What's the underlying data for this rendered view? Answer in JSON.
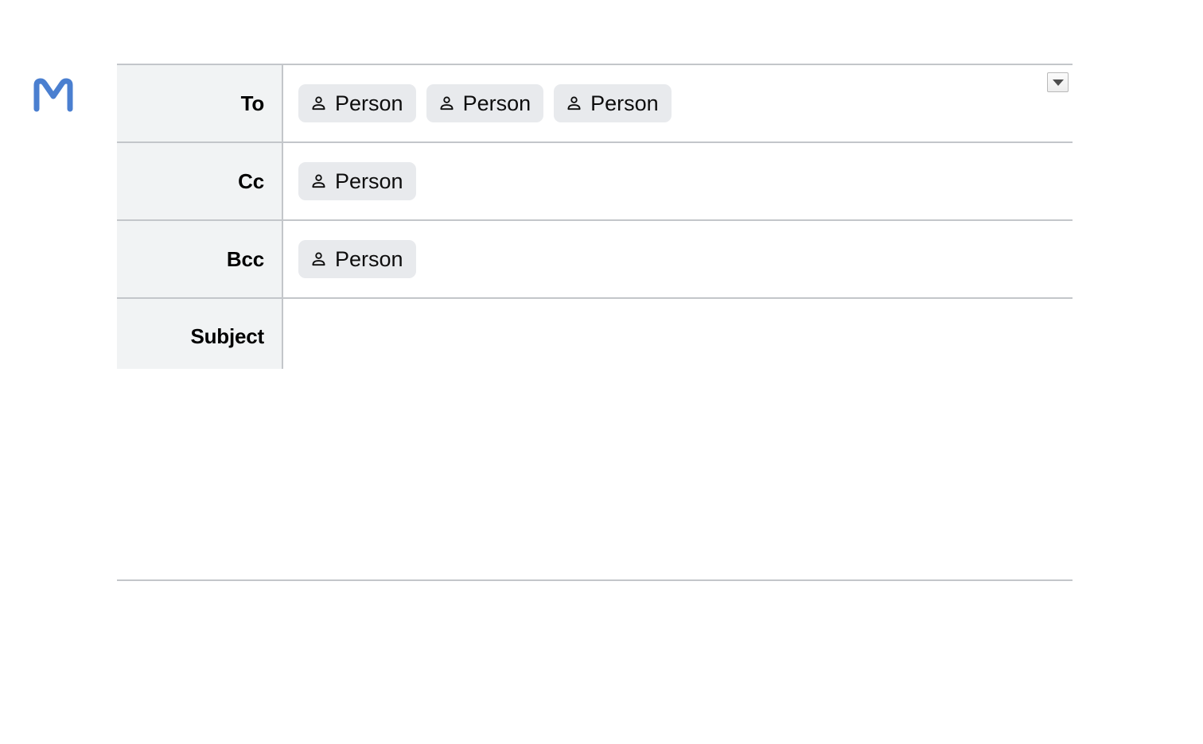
{
  "app": {
    "logo_icon": "gmail-m-logo-icon",
    "logo_color": "#4a7fd0"
  },
  "compose": {
    "expand_button": {
      "icon": "chevron-down-icon",
      "label": ""
    },
    "rows": [
      {
        "key": "to",
        "label": "To",
        "chips": [
          {
            "icon": "person-icon",
            "label": "Person"
          },
          {
            "icon": "person-icon",
            "label": "Person"
          },
          {
            "icon": "person-icon",
            "label": "Person"
          }
        ]
      },
      {
        "key": "cc",
        "label": "Cc",
        "chips": [
          {
            "icon": "person-icon",
            "label": "Person"
          }
        ]
      },
      {
        "key": "bcc",
        "label": "Bcc",
        "chips": [
          {
            "icon": "person-icon",
            "label": "Person"
          }
        ]
      },
      {
        "key": "subject",
        "label": "Subject",
        "value": "",
        "placeholder": ""
      }
    ]
  },
  "body": {
    "value": "",
    "placeholder": ""
  },
  "colors": {
    "chip_background": "#e8eaed",
    "label_background": "#f1f3f4",
    "border": "#c3c6ca",
    "text": "#0d0d0d"
  }
}
